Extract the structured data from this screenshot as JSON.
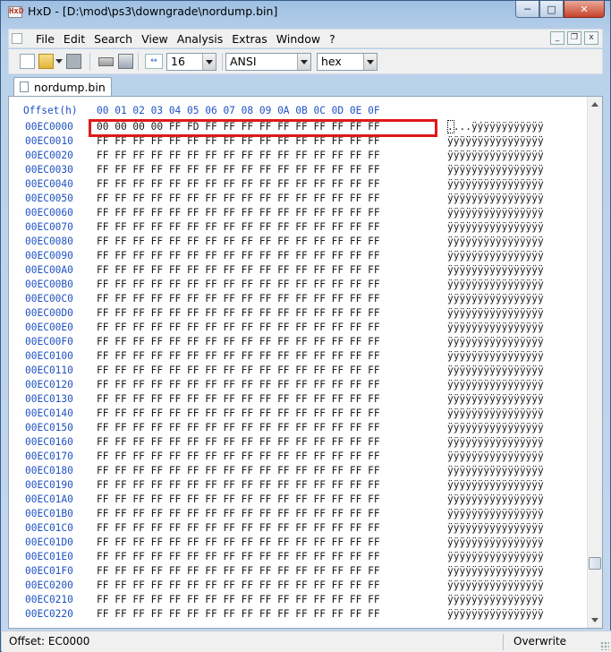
{
  "window": {
    "app_icon_text": "HxD",
    "title": "HxD - [D:\\mod\\ps3\\downgrade\\nordump.bin]",
    "minimize_glyph": "─",
    "maximize_glyph": "□",
    "close_glyph": "✕"
  },
  "menubar": {
    "items": [
      "File",
      "Edit",
      "Search",
      "View",
      "Analysis",
      "Extras",
      "Window",
      "?"
    ],
    "mdi_minimize": "_",
    "mdi_restore": "❐",
    "mdi_close": "x"
  },
  "toolbar": {
    "bytes_per_row": "16",
    "charset": "ANSI",
    "offset_base": "hex",
    "icons": [
      "new-file-icon",
      "open-file-icon",
      "save-icon",
      "open-ram-icon",
      "open-disk-icon",
      "bytes-per-row-icon"
    ]
  },
  "tabs": [
    {
      "label": "nordump.bin"
    }
  ],
  "editor": {
    "offset_header": "Offset(h)",
    "column_header": "00 01 02 03 04 05 06 07 08 09 0A 0B 0C 0D 0E 0F",
    "rows": [
      {
        "offset": "00EC0000",
        "hex": "00 00 00 00 FF FD FF FF FF FF FF FF FF FF FF FF",
        "ascii": "....ÿýÿÿÿÿÿÿÿÿÿÿ"
      },
      {
        "offset": "00EC0010",
        "hex": "FF FF FF FF FF FF FF FF FF FF FF FF FF FF FF FF",
        "ascii": "ÿÿÿÿÿÿÿÿÿÿÿÿÿÿÿÿ"
      },
      {
        "offset": "00EC0020",
        "hex": "FF FF FF FF FF FF FF FF FF FF FF FF FF FF FF FF",
        "ascii": "ÿÿÿÿÿÿÿÿÿÿÿÿÿÿÿÿ"
      },
      {
        "offset": "00EC0030",
        "hex": "FF FF FF FF FF FF FF FF FF FF FF FF FF FF FF FF",
        "ascii": "ÿÿÿÿÿÿÿÿÿÿÿÿÿÿÿÿ"
      },
      {
        "offset": "00EC0040",
        "hex": "FF FF FF FF FF FF FF FF FF FF FF FF FF FF FF FF",
        "ascii": "ÿÿÿÿÿÿÿÿÿÿÿÿÿÿÿÿ"
      },
      {
        "offset": "00EC0050",
        "hex": "FF FF FF FF FF FF FF FF FF FF FF FF FF FF FF FF",
        "ascii": "ÿÿÿÿÿÿÿÿÿÿÿÿÿÿÿÿ"
      },
      {
        "offset": "00EC0060",
        "hex": "FF FF FF FF FF FF FF FF FF FF FF FF FF FF FF FF",
        "ascii": "ÿÿÿÿÿÿÿÿÿÿÿÿÿÿÿÿ"
      },
      {
        "offset": "00EC0070",
        "hex": "FF FF FF FF FF FF FF FF FF FF FF FF FF FF FF FF",
        "ascii": "ÿÿÿÿÿÿÿÿÿÿÿÿÿÿÿÿ"
      },
      {
        "offset": "00EC0080",
        "hex": "FF FF FF FF FF FF FF FF FF FF FF FF FF FF FF FF",
        "ascii": "ÿÿÿÿÿÿÿÿÿÿÿÿÿÿÿÿ"
      },
      {
        "offset": "00EC0090",
        "hex": "FF FF FF FF FF FF FF FF FF FF FF FF FF FF FF FF",
        "ascii": "ÿÿÿÿÿÿÿÿÿÿÿÿÿÿÿÿ"
      },
      {
        "offset": "00EC00A0",
        "hex": "FF FF FF FF FF FF FF FF FF FF FF FF FF FF FF FF",
        "ascii": "ÿÿÿÿÿÿÿÿÿÿÿÿÿÿÿÿ"
      },
      {
        "offset": "00EC00B0",
        "hex": "FF FF FF FF FF FF FF FF FF FF FF FF FF FF FF FF",
        "ascii": "ÿÿÿÿÿÿÿÿÿÿÿÿÿÿÿÿ"
      },
      {
        "offset": "00EC00C0",
        "hex": "FF FF FF FF FF FF FF FF FF FF FF FF FF FF FF FF",
        "ascii": "ÿÿÿÿÿÿÿÿÿÿÿÿÿÿÿÿ"
      },
      {
        "offset": "00EC00D0",
        "hex": "FF FF FF FF FF FF FF FF FF FF FF FF FF FF FF FF",
        "ascii": "ÿÿÿÿÿÿÿÿÿÿÿÿÿÿÿÿ"
      },
      {
        "offset": "00EC00E0",
        "hex": "FF FF FF FF FF FF FF FF FF FF FF FF FF FF FF FF",
        "ascii": "ÿÿÿÿÿÿÿÿÿÿÿÿÿÿÿÿ"
      },
      {
        "offset": "00EC00F0",
        "hex": "FF FF FF FF FF FF FF FF FF FF FF FF FF FF FF FF",
        "ascii": "ÿÿÿÿÿÿÿÿÿÿÿÿÿÿÿÿ"
      },
      {
        "offset": "00EC0100",
        "hex": "FF FF FF FF FF FF FF FF FF FF FF FF FF FF FF FF",
        "ascii": "ÿÿÿÿÿÿÿÿÿÿÿÿÿÿÿÿ"
      },
      {
        "offset": "00EC0110",
        "hex": "FF FF FF FF FF FF FF FF FF FF FF FF FF FF FF FF",
        "ascii": "ÿÿÿÿÿÿÿÿÿÿÿÿÿÿÿÿ"
      },
      {
        "offset": "00EC0120",
        "hex": "FF FF FF FF FF FF FF FF FF FF FF FF FF FF FF FF",
        "ascii": "ÿÿÿÿÿÿÿÿÿÿÿÿÿÿÿÿ"
      },
      {
        "offset": "00EC0130",
        "hex": "FF FF FF FF FF FF FF FF FF FF FF FF FF FF FF FF",
        "ascii": "ÿÿÿÿÿÿÿÿÿÿÿÿÿÿÿÿ"
      },
      {
        "offset": "00EC0140",
        "hex": "FF FF FF FF FF FF FF FF FF FF FF FF FF FF FF FF",
        "ascii": "ÿÿÿÿÿÿÿÿÿÿÿÿÿÿÿÿ"
      },
      {
        "offset": "00EC0150",
        "hex": "FF FF FF FF FF FF FF FF FF FF FF FF FF FF FF FF",
        "ascii": "ÿÿÿÿÿÿÿÿÿÿÿÿÿÿÿÿ"
      },
      {
        "offset": "00EC0160",
        "hex": "FF FF FF FF FF FF FF FF FF FF FF FF FF FF FF FF",
        "ascii": "ÿÿÿÿÿÿÿÿÿÿÿÿÿÿÿÿ"
      },
      {
        "offset": "00EC0170",
        "hex": "FF FF FF FF FF FF FF FF FF FF FF FF FF FF FF FF",
        "ascii": "ÿÿÿÿÿÿÿÿÿÿÿÿÿÿÿÿ"
      },
      {
        "offset": "00EC0180",
        "hex": "FF FF FF FF FF FF FF FF FF FF FF FF FF FF FF FF",
        "ascii": "ÿÿÿÿÿÿÿÿÿÿÿÿÿÿÿÿ"
      },
      {
        "offset": "00EC0190",
        "hex": "FF FF FF FF FF FF FF FF FF FF FF FF FF FF FF FF",
        "ascii": "ÿÿÿÿÿÿÿÿÿÿÿÿÿÿÿÿ"
      },
      {
        "offset": "00EC01A0",
        "hex": "FF FF FF FF FF FF FF FF FF FF FF FF FF FF FF FF",
        "ascii": "ÿÿÿÿÿÿÿÿÿÿÿÿÿÿÿÿ"
      },
      {
        "offset": "00EC01B0",
        "hex": "FF FF FF FF FF FF FF FF FF FF FF FF FF FF FF FF",
        "ascii": "ÿÿÿÿÿÿÿÿÿÿÿÿÿÿÿÿ"
      },
      {
        "offset": "00EC01C0",
        "hex": "FF FF FF FF FF FF FF FF FF FF FF FF FF FF FF FF",
        "ascii": "ÿÿÿÿÿÿÿÿÿÿÿÿÿÿÿÿ"
      },
      {
        "offset": "00EC01D0",
        "hex": "FF FF FF FF FF FF FF FF FF FF FF FF FF FF FF FF",
        "ascii": "ÿÿÿÿÿÿÿÿÿÿÿÿÿÿÿÿ"
      },
      {
        "offset": "00EC01E0",
        "hex": "FF FF FF FF FF FF FF FF FF FF FF FF FF FF FF FF",
        "ascii": "ÿÿÿÿÿÿÿÿÿÿÿÿÿÿÿÿ"
      },
      {
        "offset": "00EC01F0",
        "hex": "FF FF FF FF FF FF FF FF FF FF FF FF FF FF FF FF",
        "ascii": "ÿÿÿÿÿÿÿÿÿÿÿÿÿÿÿÿ"
      },
      {
        "offset": "00EC0200",
        "hex": "FF FF FF FF FF FF FF FF FF FF FF FF FF FF FF FF",
        "ascii": "ÿÿÿÿÿÿÿÿÿÿÿÿÿÿÿÿ"
      },
      {
        "offset": "00EC0210",
        "hex": "FF FF FF FF FF FF FF FF FF FF FF FF FF FF FF FF",
        "ascii": "ÿÿÿÿÿÿÿÿÿÿÿÿÿÿÿÿ"
      },
      {
        "offset": "00EC0220",
        "hex": "FF FF FF FF FF FF FF FF FF FF FF FF FF FF FF FF",
        "ascii": "ÿÿÿÿÿÿÿÿÿÿÿÿÿÿÿÿ"
      }
    ]
  },
  "statusbar": {
    "offset": "Offset: EC0000",
    "mode": "Overwrite"
  },
  "colors": {
    "offset_text": "#1f52c4",
    "highlight_border": "#e01818"
  }
}
